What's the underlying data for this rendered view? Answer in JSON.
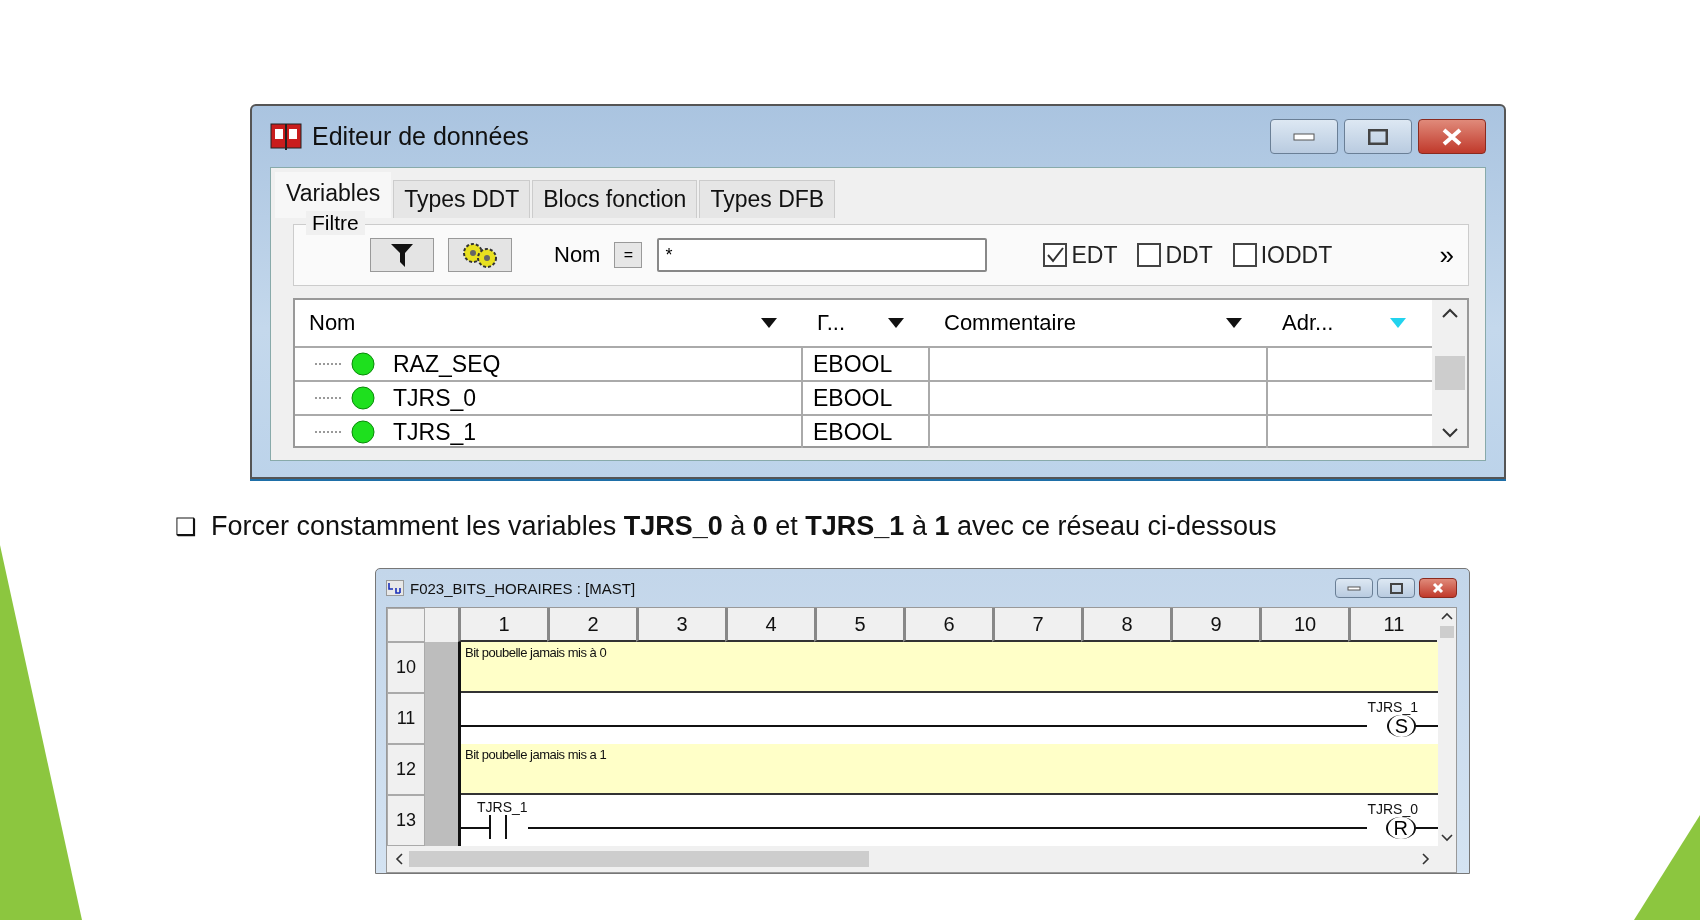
{
  "editor": {
    "title": "Editeur de données",
    "tabs": [
      {
        "label": "Variables",
        "selected": true
      },
      {
        "label": "Types DDT",
        "selected": false
      },
      {
        "label": "Blocs fonction",
        "selected": false
      },
      {
        "label": "Types DFB",
        "selected": false
      }
    ],
    "filter": {
      "label": "Filtre",
      "name_label": "Nom",
      "operator": "=",
      "value": "*",
      "more": "»",
      "options": [
        {
          "label": "EDT",
          "checked": true
        },
        {
          "label": "DDT",
          "checked": false
        },
        {
          "label": "IODDT",
          "checked": false
        }
      ]
    },
    "table": {
      "columns": [
        {
          "label": "Nom",
          "sorted": false
        },
        {
          "label": "Γ...",
          "sorted": false
        },
        {
          "label": "Commentaire",
          "sorted": false
        },
        {
          "label": "Adr...",
          "sorted": true
        }
      ],
      "rows": [
        {
          "name": "RAZ_SEQ",
          "type": "EBOOL"
        },
        {
          "name": "TJRS_0",
          "type": "EBOOL"
        },
        {
          "name": "TJRS_1",
          "type": "EBOOL"
        }
      ]
    }
  },
  "bullet": "❑",
  "instruction": "Forcer constamment les variables **TJRS_0** à **0** et **TJRS_1** à **1** avec ce réseau ci-dessous",
  "ladder": {
    "title": "F023_BITS_HORAIRES : [MAST]",
    "columns": [
      "1",
      "2",
      "3",
      "4",
      "5",
      "6",
      "7",
      "8",
      "9",
      "10",
      "11"
    ],
    "rungs": [
      {
        "number": "10",
        "kind": "comment",
        "text": "Bit poubelle jamais mis à 0"
      },
      {
        "number": "11",
        "kind": "network",
        "coil": "S",
        "variable": "TJRS_1"
      },
      {
        "number": "12",
        "kind": "comment",
        "text": "Bit poubelle jamais mis a 1"
      },
      {
        "number": "13",
        "kind": "network",
        "contact": "TJRS_1",
        "coil": "R",
        "variable": "TJRS_0"
      }
    ]
  }
}
